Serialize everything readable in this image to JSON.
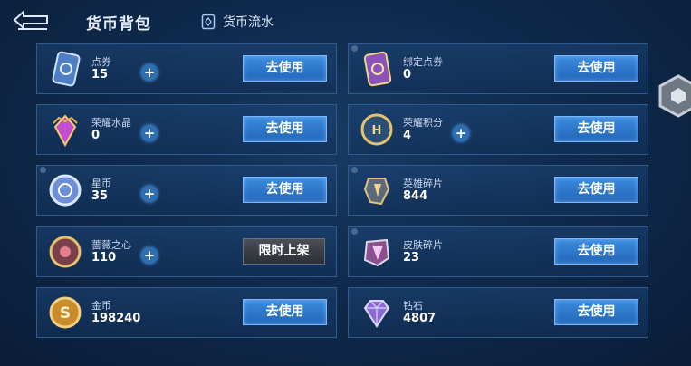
{
  "header": {
    "title": "货币背包",
    "flow_label": "货币流水"
  },
  "currencies": [
    {
      "name": "点券",
      "count": "15",
      "action": "去使用",
      "has_plus": true
    },
    {
      "name": "绑定点券",
      "count": "0",
      "action": "去使用",
      "has_plus": false
    },
    {
      "name": "荣耀水晶",
      "count": "0",
      "action": "去使用",
      "has_plus": true
    },
    {
      "name": "荣耀积分",
      "count": "4",
      "action": "去使用",
      "has_plus": true
    },
    {
      "name": "星币",
      "count": "35",
      "action": "去使用",
      "has_plus": true
    },
    {
      "name": "英雄碎片",
      "count": "844",
      "action": "去使用",
      "has_plus": false
    },
    {
      "name": "蔷薇之心",
      "count": "110",
      "action": "限时上架",
      "has_plus": true
    },
    {
      "name": "皮肤碎片",
      "count": "23",
      "action": "去使用",
      "has_plus": false
    },
    {
      "name": "金币",
      "count": "198240",
      "action": "去使用",
      "has_plus": false
    },
    {
      "name": "钻石",
      "count": "4807",
      "action": "去使用",
      "has_plus": false
    }
  ],
  "icons": {
    "back": "back-arrow-icon",
    "flow": "ledger-icon",
    "side": "hex-settings-icon"
  },
  "colors": {
    "accent": "#2d6fb0",
    "button": "#2f7ad0",
    "limited_button": "#3a3f47",
    "background": "#0f2a4d"
  }
}
